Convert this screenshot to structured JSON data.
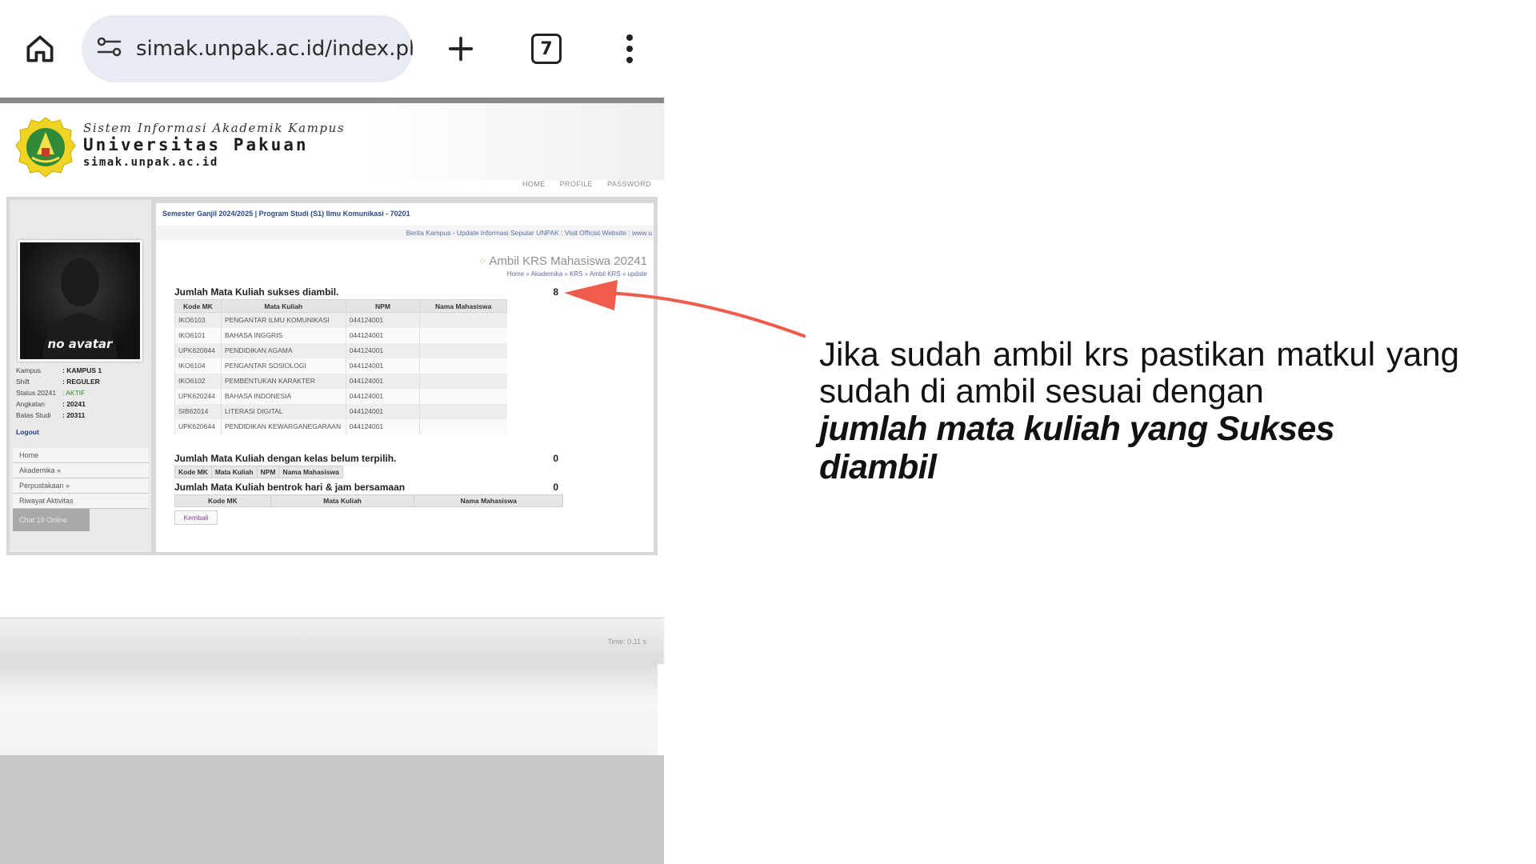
{
  "browser": {
    "url": "simak.unpak.ac.id/index.ph",
    "tab_count": "7",
    "icons": [
      "home-icon",
      "site-settings-icon",
      "new-tab-icon",
      "tab-switcher-icon",
      "more-vert-icon"
    ]
  },
  "site": {
    "tagline": "Sistem Informasi Akademik Kampus",
    "name": "Universitas Pakuan",
    "domain": "simak.unpak.ac.id",
    "nav": {
      "home": "HOME",
      "profile": "PROFILE",
      "password": "PASSWORD"
    }
  },
  "sidebar": {
    "avatar_label": "no avatar",
    "profile": [
      {
        "key": "Kampus",
        "value": ": KAMPUS 1"
      },
      {
        "key": "Shift",
        "value": ": REGULER"
      },
      {
        "key": "Status 20241",
        "value": ": AKTIF"
      },
      {
        "key": "Angkatan",
        "value": ": 20241"
      },
      {
        "key": "Batas Studi",
        "value": ": 20311"
      }
    ],
    "logout": "Logout",
    "menu": [
      "Home",
      "Akademika »",
      "Perpustakaan »",
      "Riwayat Aktivitas"
    ],
    "chat": "Chat 19 Online"
  },
  "main": {
    "semester": "Semester Ganjil 2024/2025 | Program Studi (S1) Ilmu Komunikasi - 70201",
    "news": "Berita Kampus - Update Informasi Seputar UNPAK : Visit Official Website : www.u",
    "page_title": "Ambil KRS Mahasiswa 20241",
    "breadcrumb": "Home » Akademika » KRS » Ambil KRS » update",
    "sections": {
      "success": {
        "label": "Jumlah Mata Kuliah sukses diambil.",
        "count": "8"
      },
      "unselected": {
        "label": "Jumlah Mata Kuliah dengan kelas belum terpilih.",
        "count": "0"
      },
      "conflict": {
        "label": "Jumlah Mata Kuliah bentrok hari & jam bersamaan",
        "count": "0"
      }
    },
    "success_table": {
      "headers": [
        "Kode MK",
        "Mata Kuliah",
        "NPM",
        "Nama Mahasiswa"
      ],
      "rows": [
        [
          "IKO6103",
          "PENGANTAR ILMU KOMUNIKASI",
          "044124001",
          ""
        ],
        [
          "IKO6101",
          "BAHASA INGGRIS",
          "044124001",
          ""
        ],
        [
          "UPK620844",
          "PENDIDIKAN AGAMA",
          "044124001",
          ""
        ],
        [
          "IKO6104",
          "PENGANTAR SOSIOLOGI",
          "044124001",
          ""
        ],
        [
          "IKO6102",
          "PEMBENTUKAN KARAKTER",
          "044124001",
          ""
        ],
        [
          "UPK620244",
          "BAHASA INDONESIA",
          "044124001",
          ""
        ],
        [
          "SIB62014",
          "LITERASI DIGITAL",
          "044124001",
          ""
        ],
        [
          "UPK620644",
          "PENDIDIKAN KEWARGANEGARAAN",
          "044124001",
          ""
        ]
      ]
    },
    "unselected_table": {
      "headers": [
        "Kode MK",
        "Mata Kuliah",
        "NPM",
        "Nama Mahasiswa"
      ]
    },
    "conflict_table": {
      "headers": [
        "Kode MK",
        "Mata Kuliah",
        "Nama Mahasiswa"
      ]
    },
    "back_button": "Kembali",
    "timer": "Time: 0.11 s"
  },
  "annotation": {
    "line1": "Jika sudah ambil krs pastikan matkul yang",
    "line2": "sudah di ambil sesuai dengan",
    "line3": "jumlah mata kuliah yang Sukses diambil",
    "arrow_color": "#ef5b4c"
  }
}
